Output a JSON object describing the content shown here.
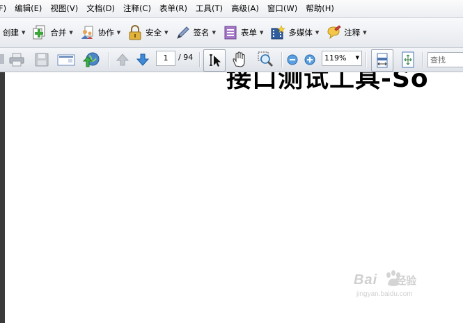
{
  "menu": {
    "items": [
      {
        "label": "F)"
      },
      {
        "label": "编辑(E)"
      },
      {
        "label": "视图(V)"
      },
      {
        "label": "文档(D)"
      },
      {
        "label": "注释(C)"
      },
      {
        "label": "表单(R)"
      },
      {
        "label": "工具(T)"
      },
      {
        "label": "高级(A)"
      },
      {
        "label": "窗口(W)"
      },
      {
        "label": "帮助(H)"
      }
    ]
  },
  "tasks": {
    "create": {
      "label": "创建",
      "icon": "create-icon"
    },
    "combine": {
      "label": "合并",
      "icon": "combine-icon"
    },
    "collaborate": {
      "label": "协作",
      "icon": "collaborate-icon"
    },
    "secure": {
      "label": "安全",
      "icon": "lock-icon"
    },
    "sign": {
      "label": "签名",
      "icon": "pen-icon"
    },
    "forms": {
      "label": "表单",
      "icon": "form-icon"
    },
    "multimedia": {
      "label": "多媒体",
      "icon": "filmstrip-icon"
    },
    "comment": {
      "label": "注释",
      "icon": "comment-icon"
    }
  },
  "navigation": {
    "current_page": "1",
    "total_pages": "/ 94",
    "zoom": "119%",
    "search_placeholder": "查找"
  },
  "document": {
    "heading": "接口测试工具-So"
  },
  "watermark": {
    "brand": "Bai",
    "brand_tail": "经验",
    "url": "jingyan.baidu.com"
  }
}
